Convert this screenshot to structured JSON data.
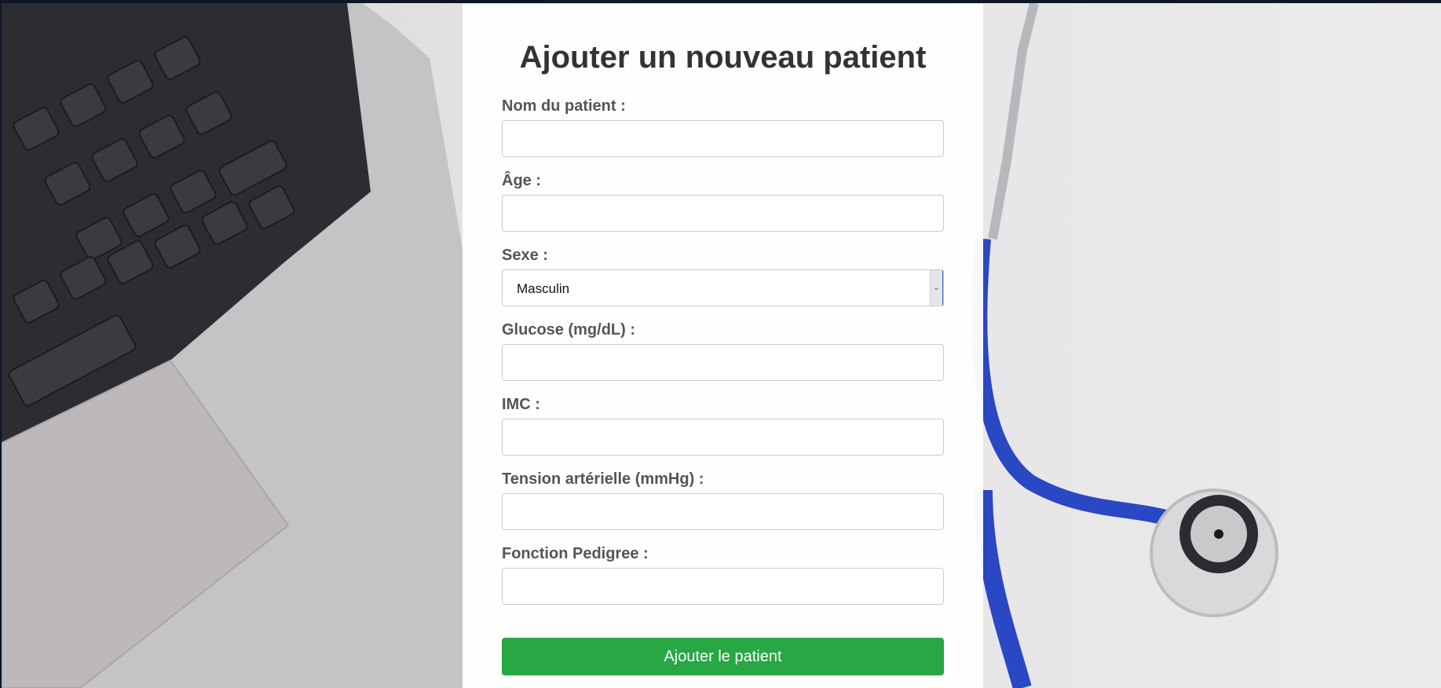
{
  "form": {
    "title": "Ajouter un nouveau patient",
    "fields": {
      "name": {
        "label": "Nom du patient :",
        "value": ""
      },
      "age": {
        "label": "Âge :",
        "value": ""
      },
      "sex": {
        "label": "Sexe :",
        "value": "Masculin"
      },
      "glucose": {
        "label": "Glucose (mg/dL) :",
        "value": ""
      },
      "bmi": {
        "label": "IMC :",
        "value": ""
      },
      "blood_pressure": {
        "label": "Tension artérielle (mmHg) :",
        "value": ""
      },
      "pedigree": {
        "label": "Fonction Pedigree :",
        "value": ""
      }
    },
    "submit_label": "Ajouter le patient"
  },
  "colors": {
    "submit_button": "#28a745",
    "card_background": "#ffffff",
    "label_text": "#555555",
    "title_text": "#333333"
  },
  "icons": {
    "select_arrow": "chevron-down-icon"
  }
}
